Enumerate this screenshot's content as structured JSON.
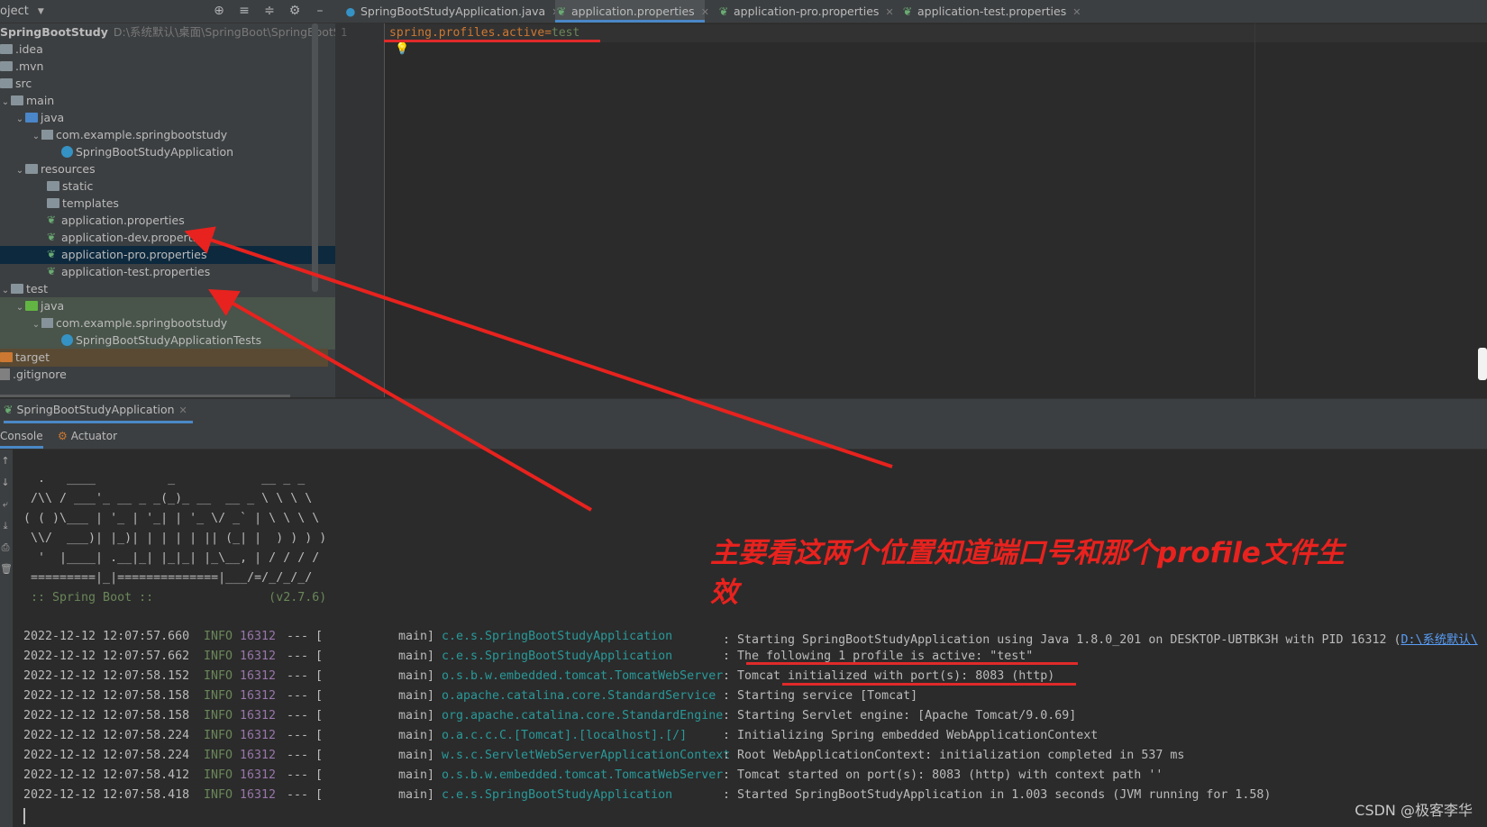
{
  "project_header": {
    "title": "oject",
    "caret": "▼"
  },
  "tree": {
    "root_label": "SpringBootStudy",
    "root_path": "D:\\系统默认\\桌面\\SpringBoot\\SpringBootStud",
    "items": [
      {
        "label": ".idea"
      },
      {
        "label": ".mvn"
      },
      {
        "label": "src"
      },
      {
        "label": "main"
      },
      {
        "label": "java"
      },
      {
        "label": "com.example.springbootstudy"
      },
      {
        "label": "SpringBootStudyApplication"
      },
      {
        "label": "resources"
      },
      {
        "label": "static"
      },
      {
        "label": "templates"
      },
      {
        "label": "application.properties"
      },
      {
        "label": "application-dev.properties"
      },
      {
        "label": "application-pro.properties"
      },
      {
        "label": "application-test.properties"
      },
      {
        "label": "test"
      },
      {
        "label": "java"
      },
      {
        "label": "com.example.springbootstudy"
      },
      {
        "label": "SpringBootStudyApplicationTests"
      },
      {
        "label": "target"
      },
      {
        "label": ".gitignore"
      }
    ]
  },
  "editor": {
    "tabs": [
      {
        "label": "SpringBootStudyApplication.java"
      },
      {
        "label": "application.properties"
      },
      {
        "label": "application-pro.properties"
      },
      {
        "label": "application-test.properties"
      }
    ],
    "line_number": "1",
    "code_key": "spring.profiles.active",
    "code_eq": "=",
    "code_value": "test"
  },
  "run": {
    "tab_label": "SpringBootStudyApplication",
    "console_tab": "Console",
    "actuator_tab": "Actuator"
  },
  "banner": [
    "  .   ____          _            __ _ _",
    " /\\\\ / ___'_ __ _ _(_)_ __  __ _ \\ \\ \\ \\",
    "( ( )\\___ | '_ | '_| | '_ \\/ _` | \\ \\ \\ \\",
    " \\\\/  ___)| |_)| | | | | || (_| |  ) ) ) )",
    "  '  |____| .__|_| |_|_| |_\\__, | / / / /",
    " =========|_|==============|___/=/_/_/_/",
    " :: Spring Boot ::                (v2.7.6)"
  ],
  "logs": [
    {
      "date": "2022-12-12 12:07:57.660",
      "level": "INFO",
      "pid": "16312",
      "sep": "--- [",
      "thread": "main]",
      "logger": "c.e.s.SpringBootStudyApplication",
      "msg": ": Starting SpringBootStudyApplication using Java 1.8.0_201 on DESKTOP-UBTBK3H with PID 16312 (",
      "link": "D:\\系统默认\\"
    },
    {
      "date": "2022-12-12 12:07:57.662",
      "level": "INFO",
      "pid": "16312",
      "sep": "--- [",
      "thread": "main]",
      "logger": "c.e.s.SpringBootStudyApplication",
      "msg": ": The following 1 profile is active: \"test\"",
      "link": ""
    },
    {
      "date": "2022-12-12 12:07:58.152",
      "level": "INFO",
      "pid": "16312",
      "sep": "--- [",
      "thread": "main]",
      "logger": "o.s.b.w.embedded.tomcat.TomcatWebServer",
      "msg": ": Tomcat initialized with port(s): 8083 (http)",
      "link": ""
    },
    {
      "date": "2022-12-12 12:07:58.158",
      "level": "INFO",
      "pid": "16312",
      "sep": "--- [",
      "thread": "main]",
      "logger": "o.apache.catalina.core.StandardService",
      "msg": ": Starting service [Tomcat]",
      "link": ""
    },
    {
      "date": "2022-12-12 12:07:58.158",
      "level": "INFO",
      "pid": "16312",
      "sep": "--- [",
      "thread": "main]",
      "logger": "org.apache.catalina.core.StandardEngine",
      "msg": ": Starting Servlet engine: [Apache Tomcat/9.0.69]",
      "link": ""
    },
    {
      "date": "2022-12-12 12:07:58.224",
      "level": "INFO",
      "pid": "16312",
      "sep": "--- [",
      "thread": "main]",
      "logger": "o.a.c.c.C.[Tomcat].[localhost].[/]",
      "msg": ": Initializing Spring embedded WebApplicationContext",
      "link": ""
    },
    {
      "date": "2022-12-12 12:07:58.224",
      "level": "INFO",
      "pid": "16312",
      "sep": "--- [",
      "thread": "main]",
      "logger": "w.s.c.ServletWebServerApplicationContext",
      "msg": ": Root WebApplicationContext: initialization completed in 537 ms",
      "link": ""
    },
    {
      "date": "2022-12-12 12:07:58.412",
      "level": "INFO",
      "pid": "16312",
      "sep": "--- [",
      "thread": "main]",
      "logger": "o.s.b.w.embedded.tomcat.TomcatWebServer",
      "msg": ": Tomcat started on port(s): 8083 (http) with context path ''",
      "link": ""
    },
    {
      "date": "2022-12-12 12:07:58.418",
      "level": "INFO",
      "pid": "16312",
      "sep": "--- [",
      "thread": "main]",
      "logger": "c.e.s.SpringBootStudyApplication",
      "msg": ": Started SpringBootStudyApplication in 1.003 seconds (JVM running for 1.58)",
      "link": ""
    }
  ],
  "annotation": {
    "text": "主要看这两个位置知道端口号和那个profile文件生效",
    "color": "#e8221e"
  },
  "watermark": "CSDN @极客李华",
  "colors": {
    "accent": "#4a88c7",
    "logger": "#299999",
    "level": "#6a8759",
    "pid": "#9876aa",
    "property_key": "#cc7832"
  }
}
